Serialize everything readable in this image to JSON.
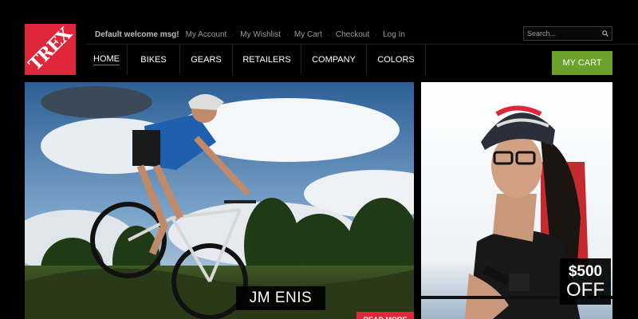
{
  "brand": {
    "logo_text": "TREX",
    "accent": "#e0263a"
  },
  "toplinks": {
    "welcome": "Default welcome msg!",
    "items": [
      "My Account",
      "My Wishlist",
      "My Cart",
      "Checkout",
      "Log In"
    ]
  },
  "search": {
    "placeholder": "Search...",
    "icon": "search-icon"
  },
  "nav": {
    "items": [
      "HOME",
      "BIKES",
      "GEARS",
      "RETAILERS",
      "COMPANY",
      "COLORS"
    ],
    "active": "HOME"
  },
  "cart": {
    "label": "MY CART",
    "color": "#6ba02a"
  },
  "hero": {
    "caption": "JM ENIS",
    "button": "READ MORE"
  },
  "side": {
    "offer_amount": "$500",
    "offer_text": "OFF"
  }
}
